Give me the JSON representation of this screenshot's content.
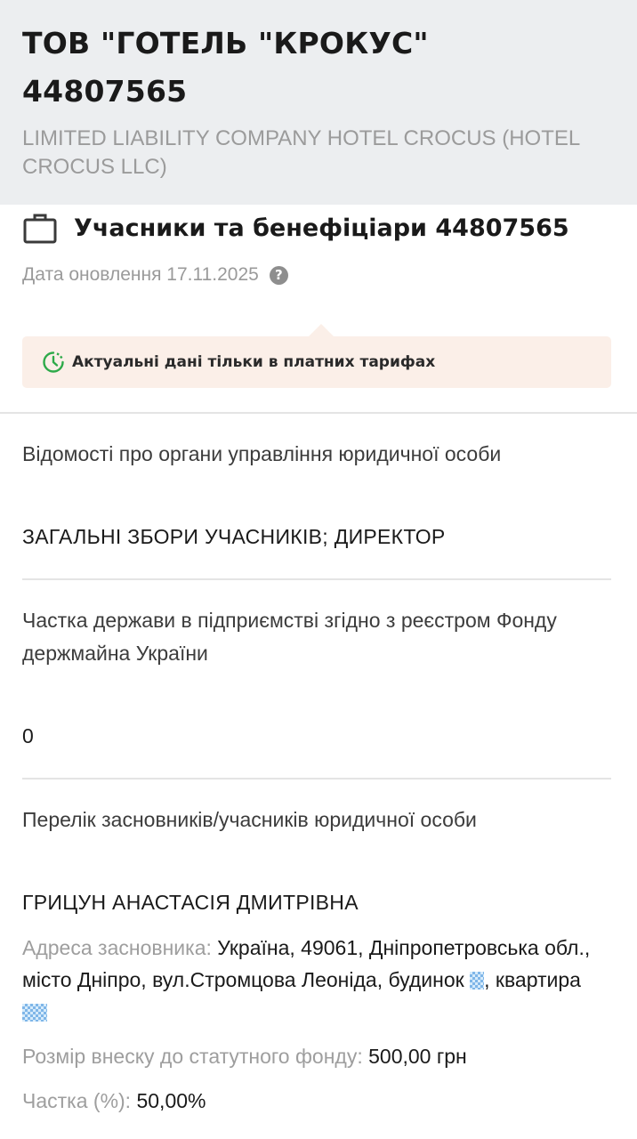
{
  "header": {
    "name_line1": "ТОВ \"ГОТЕЛЬ \"КРОКУС\"",
    "name_line2": "44807565",
    "name_en": "LIMITED LIABILITY COMPANY HOTEL CROCUS (HOTEL CROCUS LLC)"
  },
  "section": {
    "icon": "briefcase-icon",
    "title": "Учасники та бенефіціари 44807565",
    "update_label": "Дата оновлення 17.11.2025",
    "help_icon": "?"
  },
  "notice": {
    "icon": "clock-icon",
    "text": "Актуальні дані тільки в платних тарифах",
    "accent": "#2eaa4a",
    "background": "#fbefe8"
  },
  "fields": {
    "governance_label": "Відомості про органи управління юридичної особи",
    "governance_value": "ЗАГАЛЬНІ ЗБОРИ УЧАСНИКІВ; ДИРЕКТОР",
    "state_share_label": "Частка держави в підприємстві згідно з реєстром Фонду держмайна України",
    "state_share_value": "0",
    "founders_label": "Перелік засновників/учасників юридичної особи"
  },
  "founder": {
    "name": "ГРИЦУН АНАСТАСІЯ ДМИТРІВНА",
    "address_label": "Адреса засновника:",
    "address_value_part1": "Україна, 49061, Дніпропетровська обл., місто Дніпро, вул.Стромцова Леоніда, будинок",
    "address_value_part2": ",",
    "address_value_part3": "квартира",
    "contribution_label": "Розмір внеску до статутного фонду:",
    "contribution_value": "500,00 грн",
    "share_label": "Частка (%):",
    "share_value": "50,00%"
  }
}
